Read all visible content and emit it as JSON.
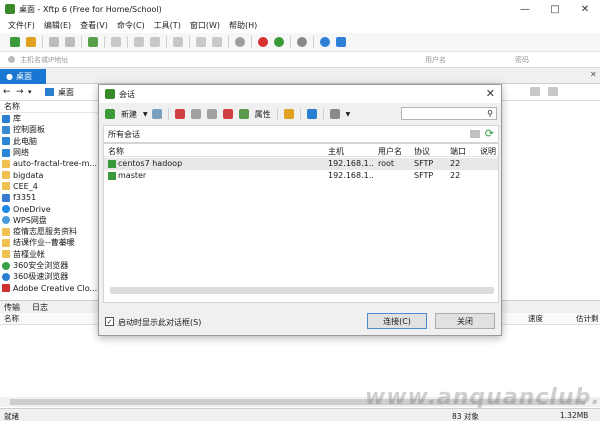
{
  "window": {
    "title": "桌面 - Xftp 6 (Free for Home/School)"
  },
  "menu": [
    "文件(F)",
    "编辑(E)",
    "查看(V)",
    "命令(C)",
    "工具(T)",
    "窗口(W)",
    "帮助(H)"
  ],
  "address": {
    "host_placeholder": "主机名或IP地址",
    "user_placeholder": "用户名",
    "pass_placeholder": "密码"
  },
  "tabs": [
    {
      "label": "桌面"
    }
  ],
  "path": {
    "current": "桌面"
  },
  "left_pane": {
    "header": "名称",
    "items": [
      "库",
      "控制面板",
      "此电脑",
      "网络",
      "auto-fractal-tree-m...",
      "bigdata",
      "CEE_4",
      "f3351",
      "OneDrive",
      "WPS网盘",
      "疫情志愿服务资料",
      "结课作业--曹蓁暖",
      "苗槿业帐",
      "360安全浏览器",
      "360极速浏览器",
      "Adobe Creative Clo..."
    ]
  },
  "transfer": {
    "tabs": [
      "传输",
      "日志"
    ],
    "columns": [
      "名称",
      "速度",
      "估计剩"
    ]
  },
  "status": {
    "left": "就绪",
    "count": "83 对象",
    "size": "1.32MB"
  },
  "watermark": "www.anquanclub.cn",
  "dialog": {
    "title": "会话",
    "new_label": "新建",
    "props_label": "属性",
    "section": "所有会话",
    "columns": [
      "名称",
      "主机",
      "用户名",
      "协议",
      "端口",
      "说明"
    ],
    "rows": [
      {
        "name": "centos7 hadoop",
        "host": "192.168.1....",
        "user": "root",
        "protocol": "SFTP",
        "port": "22",
        "desc": ""
      },
      {
        "name": "master",
        "host": "192.168.1....",
        "user": "",
        "protocol": "SFTP",
        "port": "22",
        "desc": ""
      }
    ],
    "startup_checkbox": "启动时显示此对话框(S)",
    "connect_button": "连接(C)",
    "close_button": "关闭"
  }
}
